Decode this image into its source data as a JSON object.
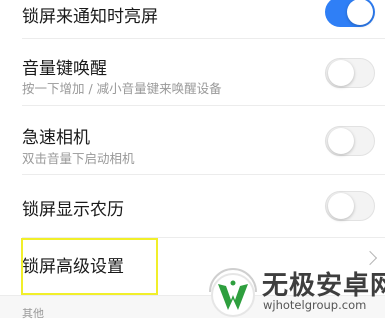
{
  "settings": {
    "items": [
      {
        "title": "锁屏来通知时亮屏",
        "toggle": true
      },
      {
        "title": "音量键唤醒",
        "subtitle": "按一下增加 / 减小音量键来唤醒设备",
        "toggle": false
      },
      {
        "title": "急速相机",
        "subtitle": "双击音量下启动相机",
        "toggle": false
      },
      {
        "title": "锁屏显示农历",
        "toggle": false
      },
      {
        "title": "锁屏高级设置"
      }
    ],
    "section_label": "其他"
  },
  "colors": {
    "toggle_on": "#2f7ff6",
    "toggle_off": "#f3f3f3",
    "highlight": "#f1ef2a",
    "logo_green": "#2e9f3e"
  },
  "watermark": {
    "title": "无极安卓网",
    "url": "wjhotelgroup.com",
    "icon": "logo-icon"
  }
}
